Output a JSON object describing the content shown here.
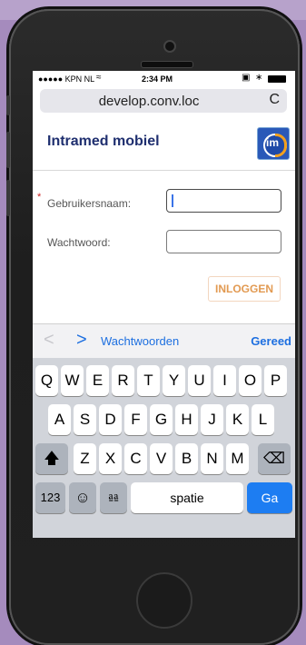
{
  "statusbar": {
    "carrier": "●●●●● KPN NL",
    "wifi_icon": "wifi-icon",
    "time": "2:34 PM",
    "battery_icon": "battery-icon"
  },
  "browser": {
    "url": "develop.conv.loc",
    "reload_icon": "C"
  },
  "app": {
    "title": "Intramed mobiel",
    "logo_text": "im"
  },
  "form": {
    "required_mark": "*",
    "username_label": "Gebruikersnaam:",
    "password_label": "Wachtwoord:",
    "username_value": "",
    "password_value": "",
    "login_label": "INLOGGEN"
  },
  "accessory": {
    "prev_icon": "<",
    "next_icon": ">",
    "passwords_label": "Wachtwoorden",
    "done_label": "Gereed"
  },
  "keyboard": {
    "row1": [
      "Q",
      "W",
      "E",
      "R",
      "T",
      "Y",
      "U",
      "I",
      "O",
      "P"
    ],
    "row2": [
      "A",
      "S",
      "D",
      "F",
      "G",
      "H",
      "J",
      "K",
      "L"
    ],
    "row3": [
      "Z",
      "X",
      "C",
      "V",
      "B",
      "N",
      "M"
    ],
    "numbers_label": "123",
    "space_label": "spatie",
    "go_label": "Ga"
  },
  "colors": {
    "accent": "#1d7df2",
    "title": "#1f2f6f",
    "login": "#e29a52",
    "background": "#a58bbd"
  }
}
